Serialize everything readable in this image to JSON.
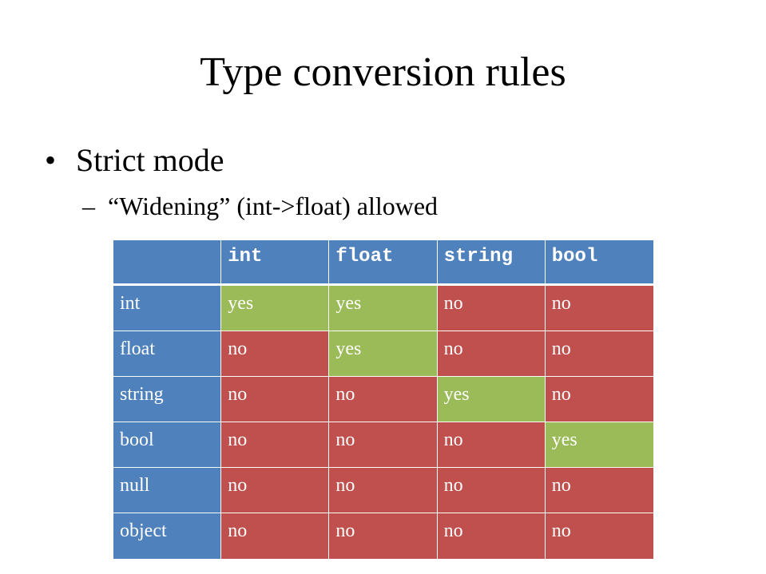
{
  "slide": {
    "title": "Type conversion rules",
    "bullet_mark": "•",
    "bullet": "Strict mode",
    "sub_mark": "–",
    "sub_bullet": "“Widening” (int->float) allowed"
  },
  "colors": {
    "header": "#4f81bd",
    "yes": "#9bbb59",
    "no": "#c0504d"
  },
  "table": {
    "corner": "",
    "columns": [
      "int",
      "float",
      "string",
      "bool"
    ],
    "rows": [
      {
        "label": "int",
        "cells": [
          "yes",
          "yes",
          "no",
          "no"
        ]
      },
      {
        "label": "float",
        "cells": [
          "no",
          "yes",
          "no",
          "no"
        ]
      },
      {
        "label": "string",
        "cells": [
          "no",
          "no",
          "yes",
          "no"
        ]
      },
      {
        "label": "bool",
        "cells": [
          "no",
          "no",
          "no",
          "yes"
        ]
      },
      {
        "label": "null",
        "cells": [
          "no",
          "no",
          "no",
          "no"
        ]
      },
      {
        "label": "object",
        "cells": [
          "no",
          "no",
          "no",
          "no"
        ]
      }
    ]
  }
}
